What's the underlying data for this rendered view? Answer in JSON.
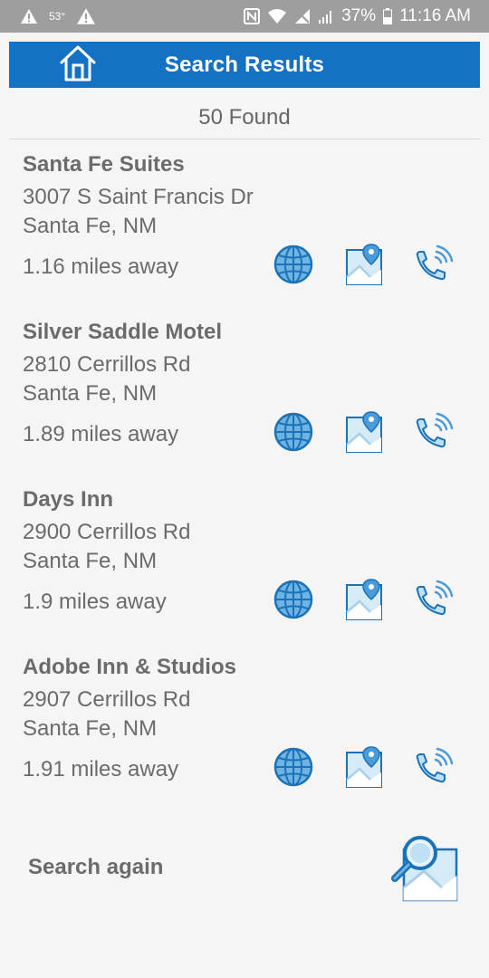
{
  "status_bar": {
    "temperature": "53°",
    "battery": "37%",
    "time": "11:16 AM",
    "icons": [
      "warning-icon",
      "warning-icon",
      "nfc-icon",
      "wifi-icon",
      "no-signal-icon",
      "signal-icon",
      "battery-icon"
    ]
  },
  "header": {
    "title": "Search Results",
    "home_icon": "home-icon",
    "color": "#1471c4"
  },
  "results_count": "50 Found",
  "results": [
    {
      "name": "Santa Fe Suites",
      "street": "3007 S Saint Francis Dr",
      "city": "Santa Fe, NM",
      "distance": "1.16 miles away"
    },
    {
      "name": "Silver Saddle Motel",
      "street": "2810 Cerrillos Rd",
      "city": "Santa Fe, NM",
      "distance": "1.89 miles away"
    },
    {
      "name": "Days Inn",
      "street": "2900 Cerrillos Rd",
      "city": "Santa Fe, NM",
      "distance": "1.9 miles away"
    },
    {
      "name": "Adobe Inn & Studios",
      "street": "2907 Cerrillos Rd",
      "city": "Santa Fe, NM",
      "distance": "1.91 miles away"
    }
  ],
  "action_icons": [
    "globe-icon",
    "map-pin-icon",
    "phone-icon"
  ],
  "footer": {
    "search_again_label": "Search again",
    "search_again_icon": "magnifier-map-icon"
  }
}
